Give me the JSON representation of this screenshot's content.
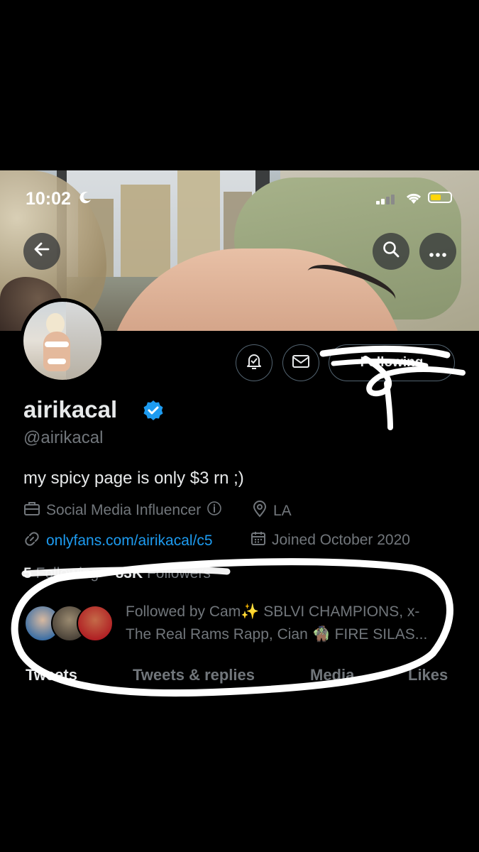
{
  "status_bar": {
    "time": "10:02"
  },
  "profile": {
    "display_name": "airikacal",
    "handle": "@airikacal",
    "bio": "my spicy page is only $3 rn ;)",
    "category": "Social Media Influencer",
    "location": "LA",
    "website": "onlyfans.com/airikacal/c5",
    "joined": "Joined October 2020",
    "following_count": "5",
    "following_label": "Following",
    "followers_count": "83K",
    "followers_label": "Followers",
    "followed_by_line1": "Followed by Cam✨ SBLVI CHAMPIONS, x-",
    "followed_by_line2": "The Real Rams Rapp, Cian 🧌 FIRE SILAS..."
  },
  "buttons": {
    "follow_label": "Following"
  },
  "tabs": [
    "Tweets",
    "Tweets & replies",
    "Media",
    "Likes"
  ],
  "icons": [
    "back-arrow-icon",
    "search-icon",
    "more-icon",
    "notification-bell-icon",
    "mail-icon",
    "verified-badge-icon",
    "briefcase-icon",
    "info-icon",
    "location-pin-icon",
    "link-icon",
    "calendar-icon"
  ],
  "colors": {
    "accent": "#1d9bf0",
    "secondary_text": "#71767b",
    "battery": "#ffd60a"
  }
}
